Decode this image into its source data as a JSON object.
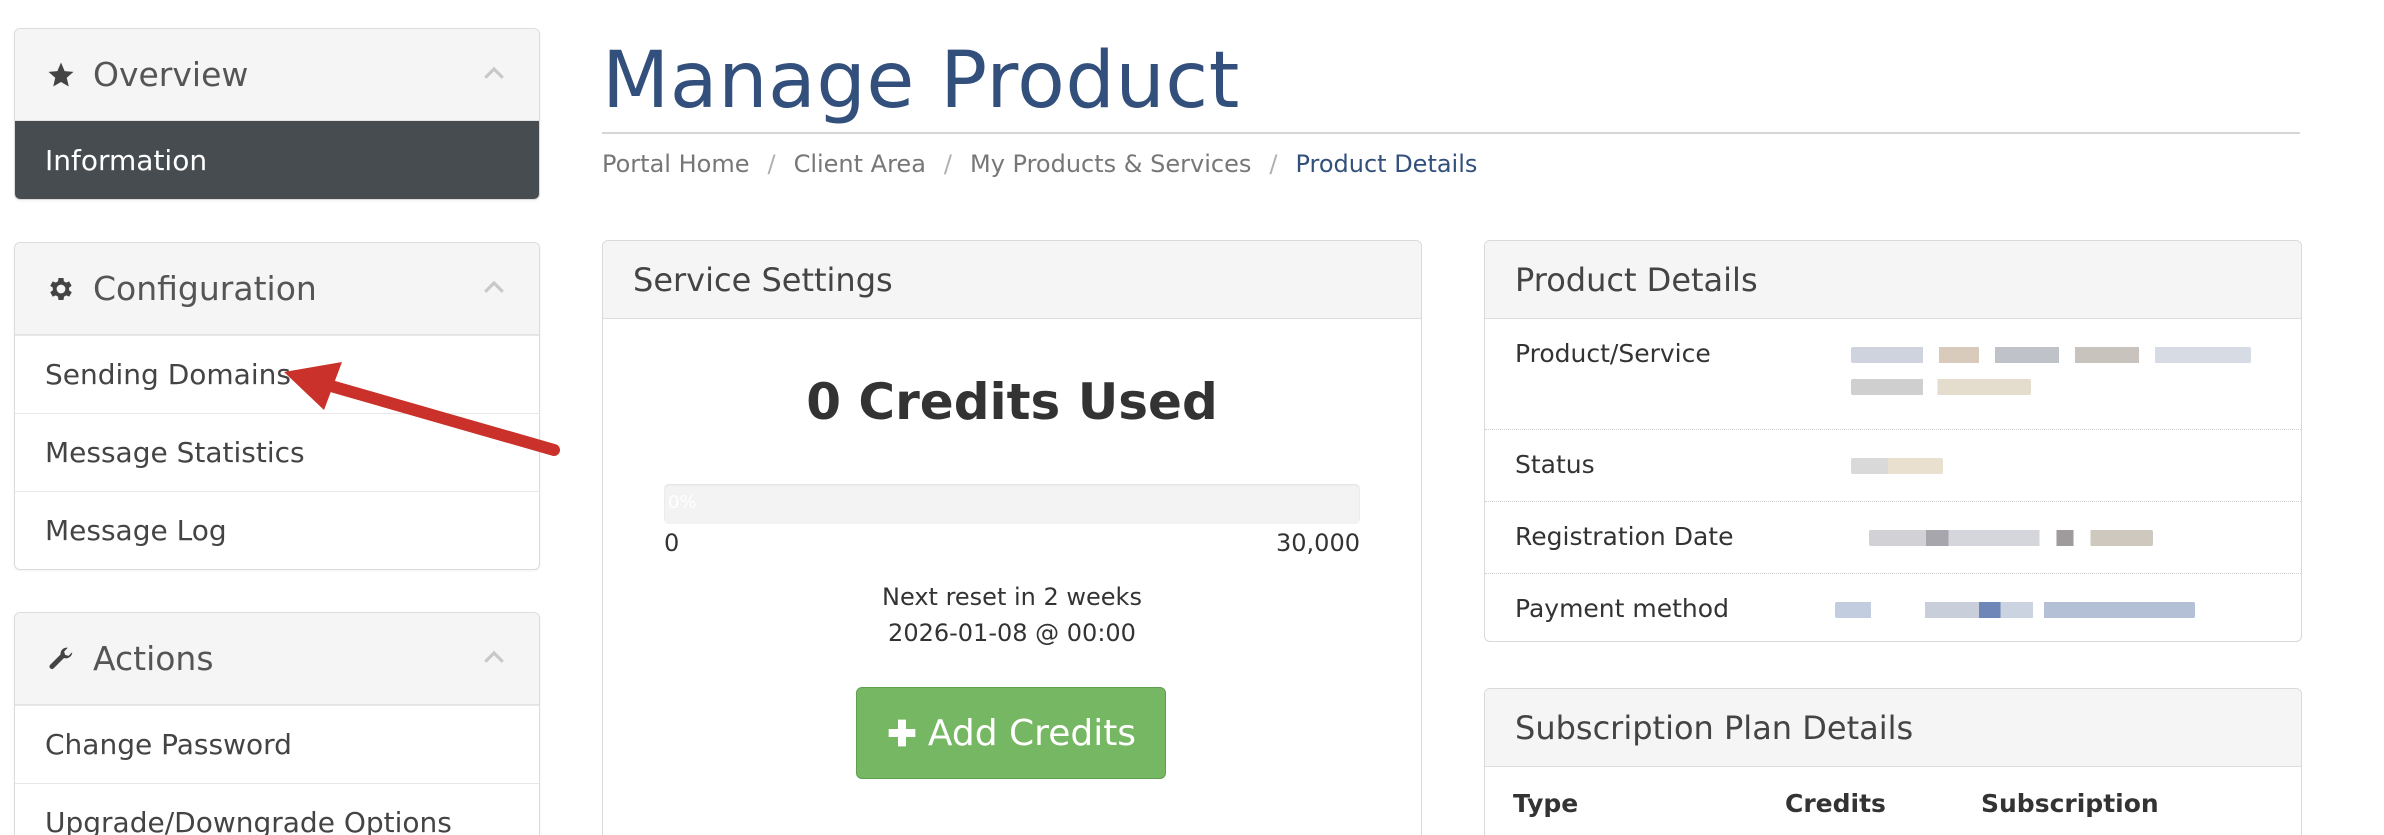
{
  "sidebar": {
    "overview": {
      "title": "Overview",
      "items": [
        "Information"
      ]
    },
    "configuration": {
      "title": "Configuration",
      "items": [
        "Sending Domains",
        "Message Statistics",
        "Message Log"
      ]
    },
    "actions": {
      "title": "Actions",
      "items": [
        "Change Password",
        "Upgrade/Downgrade Options"
      ]
    }
  },
  "page": {
    "title": "Manage Product",
    "breadcrumb": [
      "Portal Home",
      "Client Area",
      "My Products & Services",
      "Product Details"
    ]
  },
  "service_settings": {
    "title": "Service Settings",
    "credits_used": "0 Credits Used",
    "progress_label": "0%",
    "progress_fraction": 0,
    "scale_min": "0",
    "scale_max": "30,000",
    "reset_line1": "Next reset in 2 weeks",
    "reset_line2": "2026-01-08 @ 00:00",
    "add_credits_label": "Add Credits"
  },
  "product_details": {
    "title": "Product Details",
    "rows": [
      "Product/Service",
      "Status",
      "Registration Date",
      "Payment method"
    ]
  },
  "subscription": {
    "title": "Subscription Plan Details",
    "columns": [
      "Type",
      "Credits",
      "Subscription"
    ]
  },
  "colors": {
    "accent": "#33507c",
    "active_nav": "#474c51",
    "add_button": "#76b763",
    "arrow": "#c9312a"
  }
}
